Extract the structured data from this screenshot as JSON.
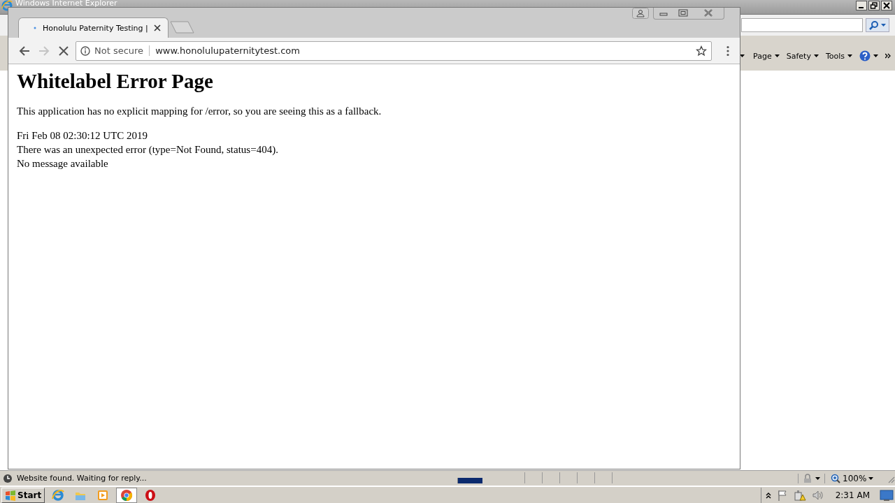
{
  "ie_window": {
    "title": "Windows Internet Explorer",
    "command_bar": [
      {
        "label": "Page"
      },
      {
        "label": "Safety"
      },
      {
        "label": "Tools"
      }
    ],
    "status": "Website found. Waiting for reply...",
    "progress": {
      "level": 0.37
    },
    "zoom": "100%"
  },
  "browser": {
    "tabs": [
      {
        "title": "Honolulu Paternity Testing |",
        "selected": true,
        "loading": true
      }
    ],
    "forward_disabled": true,
    "security": "Not secure",
    "url": "www.honolulupaternitytest.com",
    "page": {
      "heading": "Whitelabel Error Page",
      "paragraph": "This application has no explicit mapping for /error, so you are seeing this as a fallback.",
      "lines": [
        "Fri Feb 08 02:30:12 UTC 2019",
        "There was an unexpected error (type=Not Found, status=404).",
        "No message available"
      ]
    }
  },
  "taskbar": {
    "start": "Start",
    "apps": [
      {
        "kind": "ie",
        "selected": false
      },
      {
        "kind": "folder",
        "selected": false
      },
      {
        "kind": "media",
        "selected": false
      },
      {
        "kind": "chrome",
        "selected": true
      },
      {
        "kind": "opera",
        "selected": false
      }
    ],
    "clock": "2:31 AM"
  }
}
